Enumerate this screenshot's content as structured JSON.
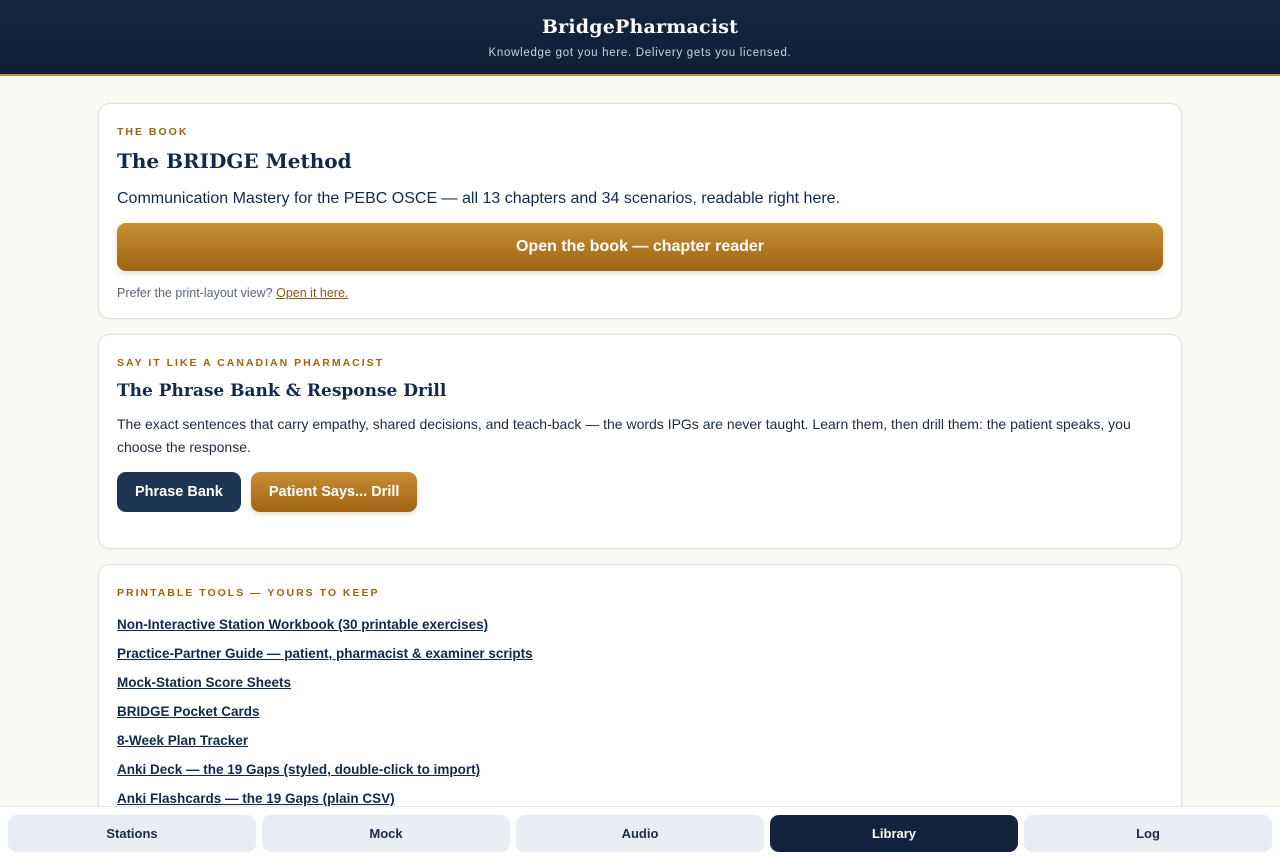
{
  "header": {
    "brand": "BridgePharmacist",
    "tagline": "Knowledge got you here. Delivery gets you licensed."
  },
  "book": {
    "kicker": "THE BOOK",
    "title": "The BRIDGE Method",
    "description": "Communication Mastery for the PEBC OSCE — all 13 chapters and 34 scenarios, readable right here.",
    "open_button": "Open the book — chapter reader",
    "print_note": "Prefer the print-layout view?",
    "print_link": "Open it here."
  },
  "phrase": {
    "kicker": "SAY IT LIKE A CANADIAN PHARMACIST",
    "title": "The Phrase Bank & Response Drill",
    "description": "The exact sentences that carry empathy, shared decisions, and teach-back — the words IPGs are never taught. Learn them, then drill them: the patient speaks, you choose the response.",
    "phrase_bank_button": "Phrase Bank",
    "drill_button": "Patient Says... Drill"
  },
  "tools": {
    "kicker": "PRINTABLE TOOLS — YOURS TO KEEP",
    "links": [
      "Non-Interactive Station Workbook (30 printable exercises)",
      "Practice-Partner Guide — patient, pharmacist & examiner scripts",
      "Mock-Station Score Sheets",
      "BRIDGE Pocket Cards",
      "8-Week Plan Tracker",
      "Anki Deck — the 19 Gaps (styled, double-click to import)",
      "Anki Flashcards — the 19 Gaps (plain CSV)"
    ]
  },
  "nav": {
    "tabs": [
      "Stations",
      "Mock",
      "Audio",
      "Library",
      "Log"
    ],
    "active": "Library"
  },
  "colors": {
    "header_bg": "#0d2038",
    "accent_gold": "#b07a22",
    "navy": "#1c3552",
    "page_bg": "#faf8f3"
  }
}
